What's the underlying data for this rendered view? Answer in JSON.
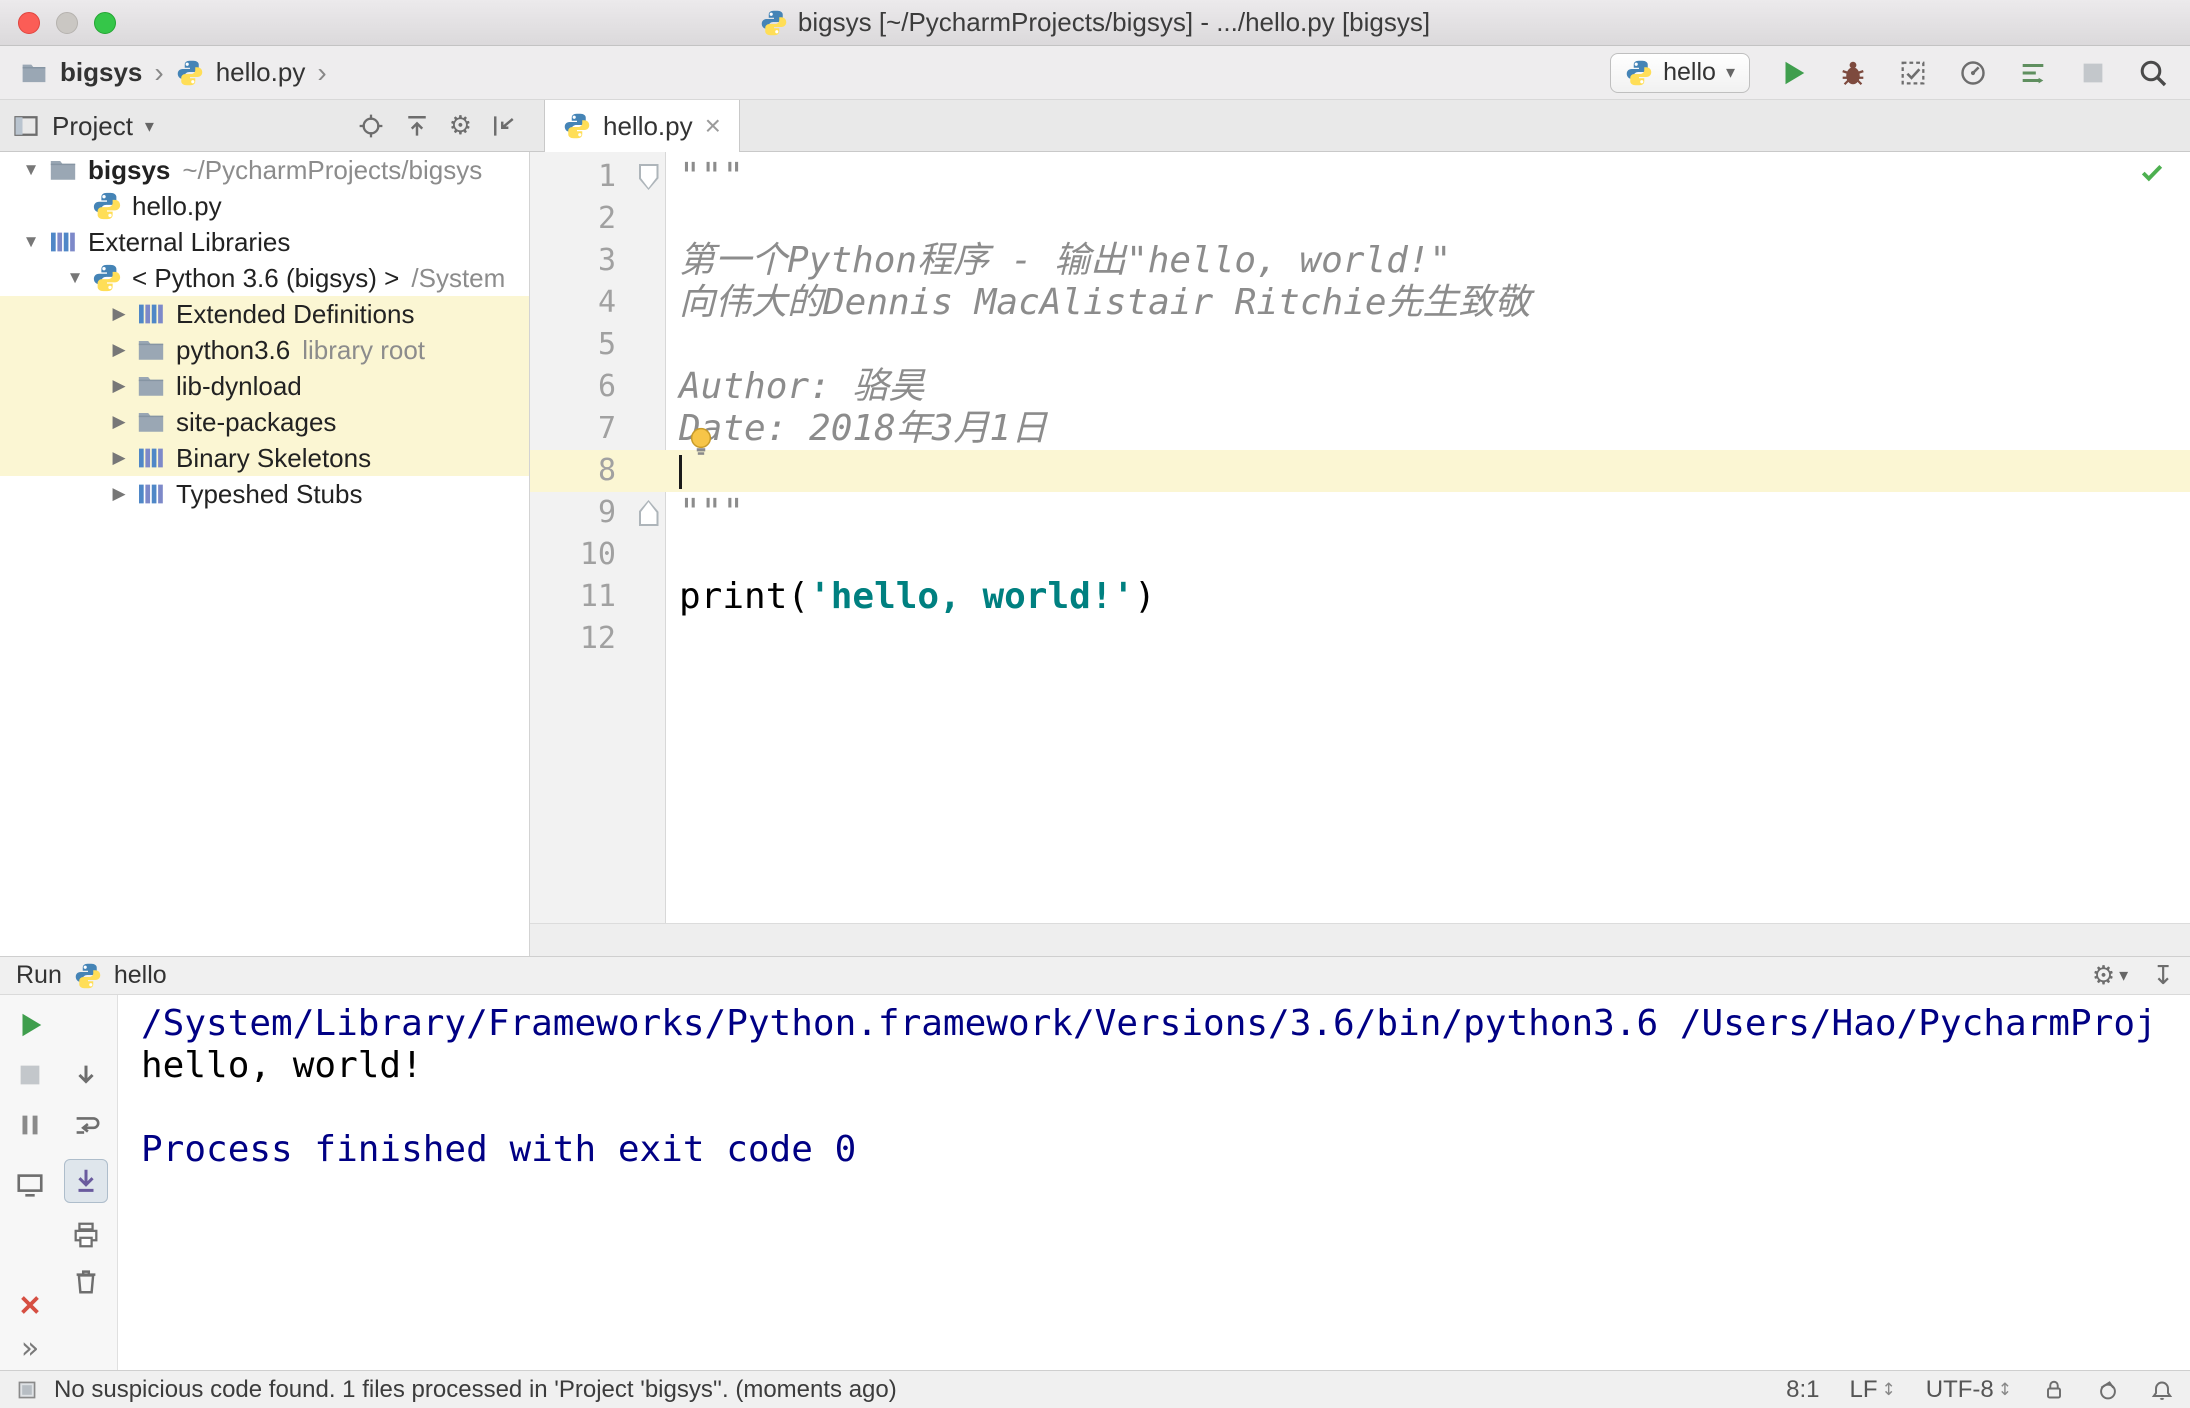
{
  "glyphs": {
    "close": "×",
    "chevron_down": "▾",
    "breadcrumb_separator": "›",
    "tree_expanded": "▼",
    "tree_collapsed": "▶",
    "more": "»",
    "gear": "⚙",
    "hide_panel": "↧",
    "updown_arrows": "↕"
  },
  "titlebar": {
    "title": "bigsys [~/PycharmProjects/bigsys] - .../hello.py [bigsys]"
  },
  "navbar": {
    "breadcrumbs": [
      {
        "label": "bigsys"
      },
      {
        "label": "hello.py"
      }
    ],
    "run_config": {
      "value": "hello"
    }
  },
  "project_panel": {
    "title": "Project",
    "tree": [
      {
        "label": "bigsys",
        "suffix": "~/PycharmProjects/bigsys",
        "level": 0,
        "state": "expanded",
        "icon": "folder",
        "bold": true
      },
      {
        "label": "hello.py",
        "level": 1,
        "icon": "python"
      },
      {
        "label": "External Libraries",
        "level": 0,
        "state": "expanded",
        "icon": "library"
      },
      {
        "label": "< Python 3.6 (bigsys) >",
        "suffix": "/System",
        "level": 1,
        "state": "expanded",
        "icon": "python"
      },
      {
        "label": "Extended Definitions",
        "level": 2,
        "state": "collapsed",
        "icon": "library",
        "highlight": true
      },
      {
        "label": "python3.6",
        "suffix": "library root",
        "level": 2,
        "state": "collapsed",
        "icon": "folder",
        "highlight": true
      },
      {
        "label": "lib-dynload",
        "level": 2,
        "state": "collapsed",
        "icon": "folder",
        "highlight": true
      },
      {
        "label": "site-packages",
        "level": 2,
        "state": "collapsed",
        "icon": "folder",
        "highlight": true
      },
      {
        "label": "Binary Skeletons",
        "level": 2,
        "state": "collapsed",
        "icon": "library",
        "highlight": true
      },
      {
        "label": "Typeshed Stubs",
        "level": 2,
        "state": "collapsed",
        "icon": "library"
      }
    ]
  },
  "editor": {
    "tab_label": "hello.py",
    "lines": [
      {
        "n": 1,
        "fold": "down",
        "segments": [
          {
            "t": "\"\"\"",
            "c": "doc"
          }
        ]
      },
      {
        "n": 2,
        "segments": []
      },
      {
        "n": 3,
        "segments": [
          {
            "t": "第一个Python程序 - 输出\"hello, world!\"",
            "c": "doc"
          }
        ]
      },
      {
        "n": 4,
        "segments": [
          {
            "t": "向伟大的Dennis MacAlistair Ritchie先生致敬",
            "c": "doc"
          }
        ]
      },
      {
        "n": 5,
        "segments": []
      },
      {
        "n": 6,
        "segments": [
          {
            "t": "Author: 骆昊",
            "c": "doc"
          }
        ]
      },
      {
        "n": 7,
        "segments": [
          {
            "t": "Date: 2018年3月1日",
            "c": "doc"
          }
        ]
      },
      {
        "n": 8,
        "current": true,
        "segments": []
      },
      {
        "n": 9,
        "fold": "up",
        "segments": [
          {
            "t": "\"\"\"",
            "c": "doc"
          }
        ]
      },
      {
        "n": 10,
        "segments": []
      },
      {
        "n": 11,
        "segments": [
          {
            "t": "print",
            "c": "plain"
          },
          {
            "t": "(",
            "c": "plain"
          },
          {
            "t": "'hello, world!'",
            "c": "string"
          },
          {
            "t": ")",
            "c": "plain"
          }
        ]
      },
      {
        "n": 12,
        "segments": []
      }
    ]
  },
  "run_panel": {
    "title": "Run",
    "config": "hello",
    "console": [
      {
        "type": "system",
        "text": "/System/Library/Frameworks/Python.framework/Versions/3.6/bin/python3.6 /Users/Hao/PycharmProj"
      },
      {
        "type": "stdout",
        "text": "hello, world!"
      },
      {
        "type": "stdout",
        "text": ""
      },
      {
        "type": "system",
        "text": "Process finished with exit code 0"
      }
    ]
  },
  "statusbar": {
    "message": "No suspicious code found. 1 files processed in 'Project 'bigsys''. (moments ago)",
    "caret_position": "8:1",
    "line_separator": "LF",
    "encoding": "UTF-8"
  },
  "colors": {
    "string": "#008080",
    "docstring": "#8c8c8c",
    "console_system": "#000084",
    "run_green": "#3f9e4d",
    "highlight_yellow": "#fbf6d3"
  }
}
